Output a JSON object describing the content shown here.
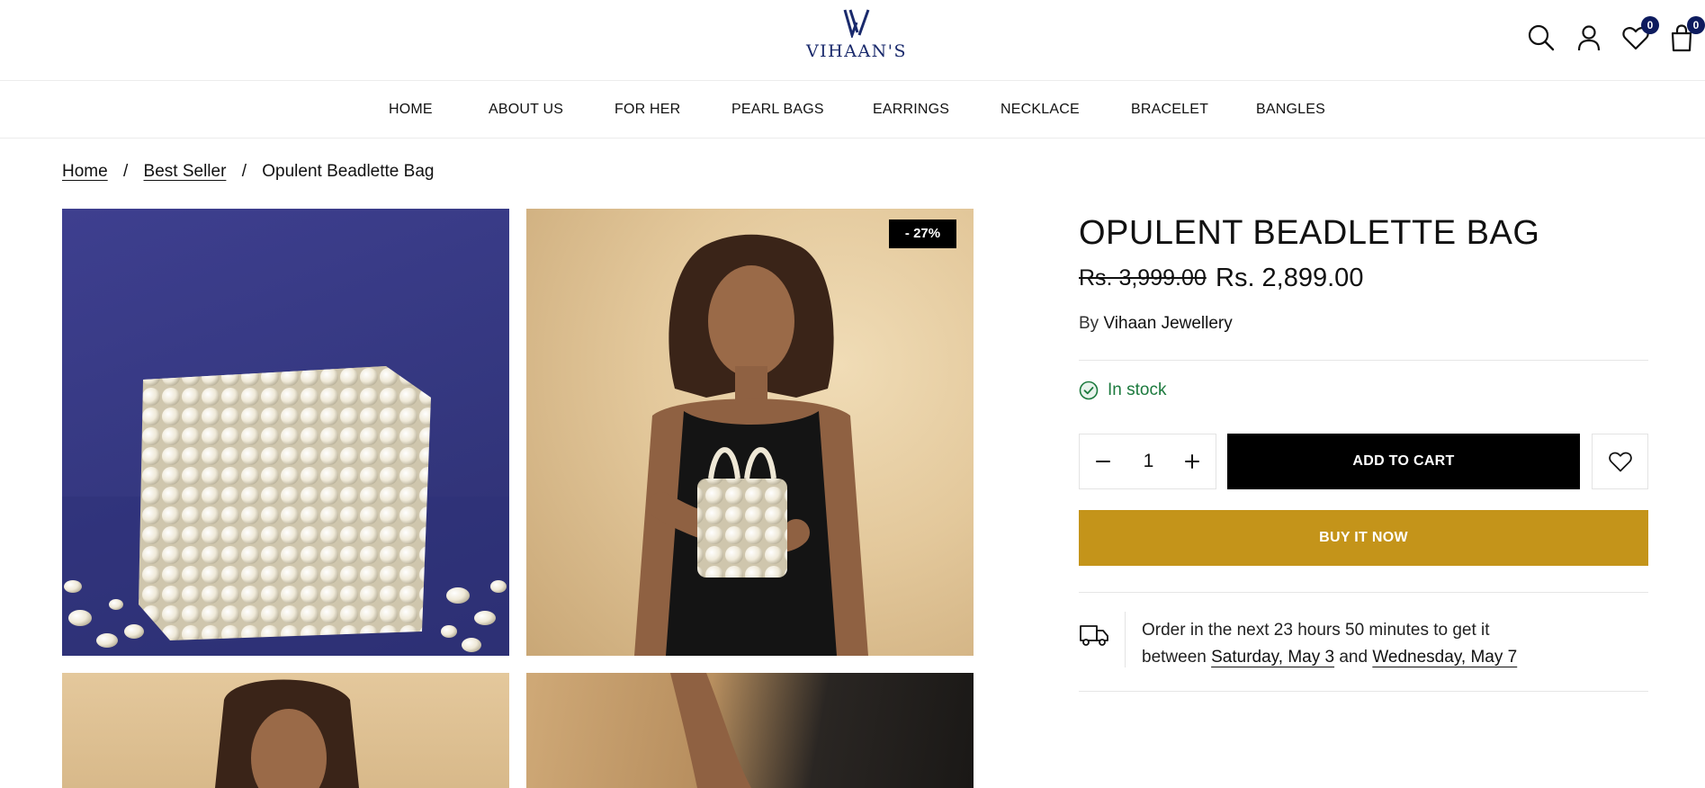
{
  "brand": {
    "name": "VIHAAN'S",
    "color": "#1a2a6c"
  },
  "header": {
    "wishlist_count": "0",
    "cart_count": "0"
  },
  "nav": {
    "items": [
      "HOME",
      "ABOUT US",
      "FOR HER",
      "PEARL BAGS",
      "EARRINGS",
      "NECKLACE",
      "BRACELET",
      "BANGLES"
    ]
  },
  "breadcrumb": {
    "home": "Home",
    "category": "Best Seller",
    "current": "Opulent Beadlette Bag",
    "separator": "/"
  },
  "gallery": {
    "discount_badge": "- 27%"
  },
  "product": {
    "title": "OPULENT BEADLETTE BAG",
    "price_original": "Rs. 3,999.00",
    "price_sale": "Rs. 2,899.00",
    "vendor_prefix": "By",
    "vendor": "Vihaan Jewellery",
    "stock_status": "In stock",
    "quantity": "1",
    "add_to_cart_label": "ADD TO CART",
    "buy_now_label": "BUY IT NOW"
  },
  "delivery": {
    "line1": "Order in the next 23 hours 50 minutes to get it",
    "between": "between",
    "date_from": "Saturday, May 3",
    "and": "and",
    "date_to": "Wednesday, May 7"
  },
  "colors": {
    "buy_now": "#c4941a",
    "add_to_cart": "#000000",
    "in_stock": "#1c7a3e",
    "badge": "#0d1b5e"
  },
  "icons": [
    "search-icon",
    "account-icon",
    "heart-icon",
    "bag-icon",
    "minus-icon",
    "plus-icon",
    "check-circle-icon",
    "truck-icon"
  ]
}
